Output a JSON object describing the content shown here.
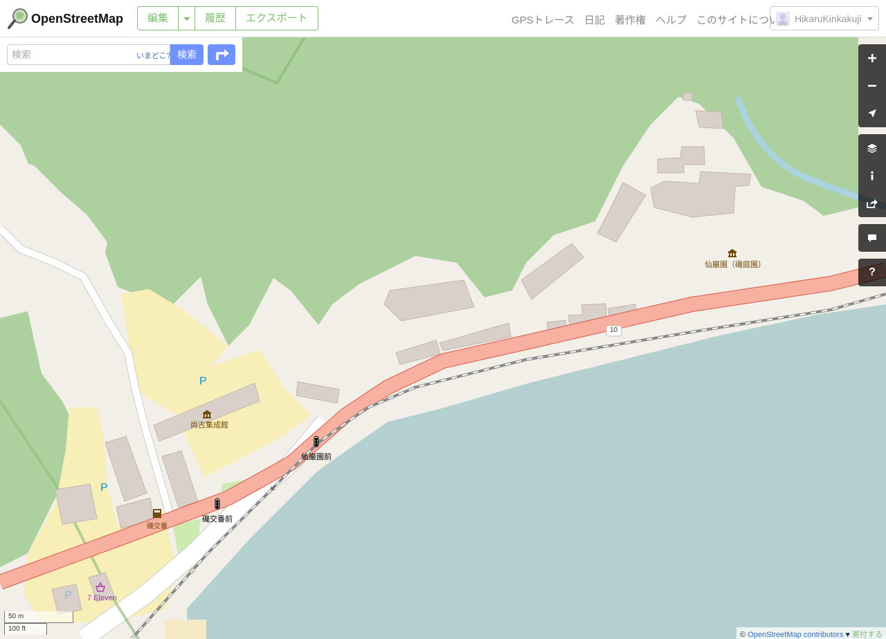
{
  "header": {
    "brand": "OpenStreetMap",
    "edit_label": "編集",
    "history_label": "履歴",
    "export_label": "エクスポート",
    "nav": [
      "GPSトレース",
      "日記",
      "著作権",
      "ヘルプ",
      "このサイトについて"
    ],
    "username": "HikaruKinkakuji"
  },
  "search": {
    "placeholder": "検索",
    "where_label": "いまどこ?",
    "button_label": "検索"
  },
  "controls": {
    "zoom_in": "+",
    "zoom_out": "−",
    "query": "?"
  },
  "map_labels": {
    "senganen": "仙巌園（磯庭園）",
    "shoko": "尚古集成館",
    "senganen_mae": "仙巌園前",
    "iso_koban_mae": "磯交番前",
    "iso_koban": "磯交番",
    "seven_eleven": "7 Eleven",
    "route": "10",
    "parking": "P"
  },
  "scale": {
    "metric": "50 m",
    "imperial": "100 ft"
  },
  "attribution": {
    "prefix": "©",
    "link": "OpenStreetMap contributors",
    "heart": "♥",
    "donate": "寄付する"
  },
  "colors": {
    "forest": "#add19e",
    "land": "#f2efe9",
    "water": "#aad3df",
    "parking_area": "#f7efb7",
    "building": "#d9d0c9",
    "primary_road": "#f8b0a0",
    "primary_road_casing": "#d6584a",
    "accent": "#7ebc6f",
    "button": "#7092ff"
  }
}
